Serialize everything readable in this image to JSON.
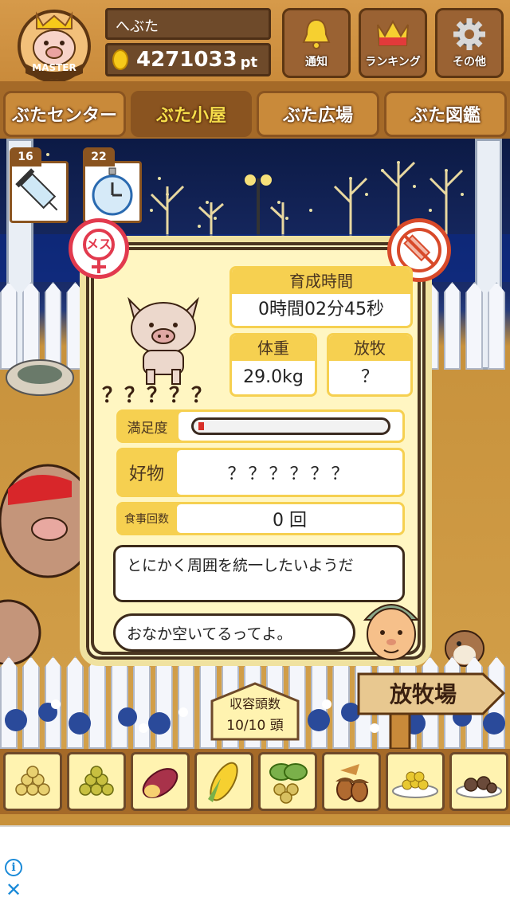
{
  "header": {
    "badge_text": "MASTER",
    "username": "へぶた",
    "points_value": "4271033",
    "points_unit": "pt",
    "buttons": [
      {
        "label": "通知",
        "icon": "bell-icon"
      },
      {
        "label": "ランキング",
        "icon": "crown-icon"
      },
      {
        "label": "その他",
        "icon": "gear-icon"
      }
    ]
  },
  "tabs": [
    {
      "label": "ぶたセンター",
      "active": false
    },
    {
      "label": "ぶた小屋",
      "active": true
    },
    {
      "label": "ぶた広場",
      "active": false
    },
    {
      "label": "ぶた図鑑",
      "active": false
    }
  ],
  "items": [
    {
      "count": "16",
      "icon": "syringe-icon"
    },
    {
      "count": "22",
      "icon": "stopwatch-icon"
    }
  ],
  "pig_card": {
    "gender_label": "メス",
    "pig_name": "？？？？？",
    "growth_time_label": "育成時間",
    "growth_time_value": "0時間02分45秒",
    "weight_label": "体重",
    "weight_value": "29.0kg",
    "grazing_label": "放牧",
    "grazing_value": "？",
    "satisfaction_label": "満足度",
    "satisfaction_fraction": 0.03,
    "favorite_label": "好物",
    "favorite_value": "？？？？？？",
    "meals_label": "食事回数",
    "meals_value": "0 回",
    "comment_1": "とにかく周囲を統一したいようだ",
    "comment_2": "おなか空いてるってよ。"
  },
  "capacity": {
    "label": "収容頭数",
    "value": "10/10 頭"
  },
  "pasture_sign": "放牧場",
  "foods": [
    {
      "icon": "soybeans-icon"
    },
    {
      "icon": "green-peas-icon"
    },
    {
      "icon": "sweet-potato-icon"
    },
    {
      "icon": "corn-icon"
    },
    {
      "icon": "vegetable-icon"
    },
    {
      "icon": "acorn-icon"
    },
    {
      "icon": "rice-bowl-icon"
    },
    {
      "icon": "meat-dish-icon"
    }
  ],
  "colors": {
    "wood": "#c98a3a",
    "dark_wood": "#6e4a2a",
    "card_bg": "#fff6c2",
    "label_yellow": "#f6d050",
    "female_red": "#e23a4e",
    "night_sky": "#0c1a45"
  }
}
